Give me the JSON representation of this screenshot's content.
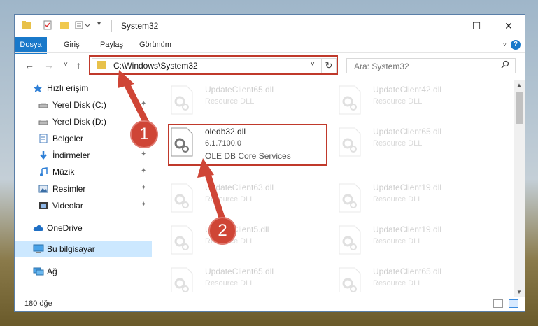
{
  "window": {
    "title": "System32",
    "controls": [
      "–",
      "☐",
      "✕"
    ]
  },
  "ribbon": {
    "tabs": [
      "Dosya",
      "Giriş",
      "Paylaş",
      "Görünüm"
    ],
    "help": "?"
  },
  "navigation": {
    "back": "←",
    "forward": "→",
    "recent": "˅",
    "up": "↑",
    "address": "C:\\Windows\\System32",
    "address_dropdown": "˅",
    "refresh": "↻",
    "search_placeholder": "Ara: System32",
    "search_icon": "⚲"
  },
  "sidebar": {
    "items": [
      {
        "label": "Hızlı erişim",
        "icon": "star-icon"
      },
      {
        "label": "Yerel Disk (C:)",
        "icon": "drive-icon"
      },
      {
        "label": "Yerel Disk (D:)",
        "icon": "drive-icon"
      },
      {
        "label": "Belgeler",
        "icon": "documents-icon"
      },
      {
        "label": "İndirmeler",
        "icon": "downloads-icon"
      },
      {
        "label": "Müzik",
        "icon": "music-icon"
      },
      {
        "label": "Resimler",
        "icon": "pictures-icon"
      },
      {
        "label": "Videolar",
        "icon": "videos-icon"
      },
      {
        "label": "OneDrive",
        "icon": "cloud-icon"
      },
      {
        "label": "Bu bilgisayar",
        "icon": "computer-icon"
      },
      {
        "label": "Ağ",
        "icon": "network-icon"
      }
    ],
    "pin_glyph": "📌"
  },
  "files": {
    "left": [
      {
        "name": "UpdateClient65.dll",
        "desc": "Resource DLL"
      },
      {
        "name": "oledb32.dll",
        "version": "6.1.7100.0",
        "desc": "OLE DB Core Services"
      },
      {
        "name": "UpdateClient63.dll",
        "desc": "Resource DLL"
      },
      {
        "name": "UpdateClient5.dll",
        "desc": "Resource DLL"
      },
      {
        "name": "UpdateClient65.dll",
        "desc": "Resource DLL"
      }
    ],
    "right": [
      {
        "name": "UpdateClient42.dll",
        "desc": "Resource DLL"
      },
      {
        "name": "UpdateClient65.dll",
        "desc": "Resource DLL"
      },
      {
        "name": "UpdateClient19.dll",
        "desc": "Resource DLL"
      },
      {
        "name": "UpdateClient19.dll",
        "desc": "Resource DLL"
      },
      {
        "name": "UpdateClient65.dll",
        "desc": "Resource DLL"
      }
    ]
  },
  "status": {
    "count": "180 öğe"
  },
  "annotations": {
    "step1": "1",
    "step2": "2",
    "color": "#c0392b"
  }
}
